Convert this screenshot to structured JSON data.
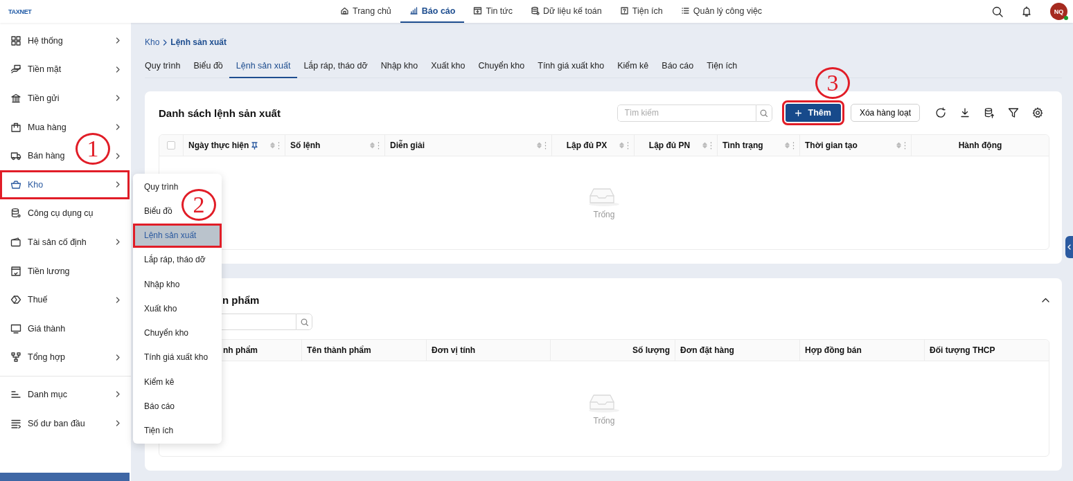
{
  "logo": {
    "text": "TAXNET"
  },
  "top_nav": [
    {
      "label": "Trang chủ",
      "selected": false
    },
    {
      "label": "Báo cáo",
      "selected": true
    },
    {
      "label": "Tin tức",
      "selected": false
    },
    {
      "label": "Dữ liệu kế toán",
      "selected": false
    },
    {
      "label": "Tiện ích",
      "selected": false
    },
    {
      "label": "Quản lý công việc",
      "selected": false
    }
  ],
  "user": {
    "initials": "NQ",
    "online": true
  },
  "sidebar": {
    "groups": [
      [
        {
          "label": "Hệ thống",
          "has_submenu": true,
          "selected": false,
          "highlighted": false
        },
        {
          "label": "Tiền mặt",
          "has_submenu": true,
          "selected": false,
          "highlighted": false
        },
        {
          "label": "Tiền gửi",
          "has_submenu": true,
          "selected": false,
          "highlighted": false
        },
        {
          "label": "Mua hàng",
          "has_submenu": true,
          "selected": false,
          "highlighted": false
        },
        {
          "label": "Bán hàng",
          "has_submenu": true,
          "selected": false,
          "highlighted": false
        },
        {
          "label": "Kho",
          "has_submenu": true,
          "selected": true,
          "highlighted": true
        },
        {
          "label": "Công cụ dụng cụ",
          "has_submenu": false,
          "selected": false,
          "highlighted": false
        },
        {
          "label": "Tài sản cố định",
          "has_submenu": true,
          "selected": false,
          "highlighted": false
        },
        {
          "label": "Tiền lương",
          "has_submenu": false,
          "selected": false,
          "highlighted": false
        },
        {
          "label": "Thuế",
          "has_submenu": true,
          "selected": false,
          "highlighted": false
        },
        {
          "label": "Giá thành",
          "has_submenu": false,
          "selected": false,
          "highlighted": false
        },
        {
          "label": "Tổng hợp",
          "has_submenu": true,
          "selected": false,
          "highlighted": false
        }
      ],
      [
        {
          "label": "Danh mục",
          "has_submenu": true,
          "selected": false,
          "highlighted": false
        },
        {
          "label": "Số dư ban đầu",
          "has_submenu": true,
          "selected": false,
          "highlighted": false
        }
      ]
    ]
  },
  "submenu": [
    {
      "label": "Quy trình",
      "selected": false,
      "highlighted": false
    },
    {
      "label": "Biểu đồ",
      "selected": false,
      "highlighted": false
    },
    {
      "label": "Lệnh sản xuất",
      "selected": true,
      "highlighted": true
    },
    {
      "label": "Lắp ráp, tháo dỡ",
      "selected": false,
      "highlighted": false
    },
    {
      "label": "Nhập kho",
      "selected": false,
      "highlighted": false
    },
    {
      "label": "Xuất kho",
      "selected": false,
      "highlighted": false
    },
    {
      "label": "Chuyển kho",
      "selected": false,
      "highlighted": false
    },
    {
      "label": "Tính giá xuất kho",
      "selected": false,
      "highlighted": false
    },
    {
      "label": "Kiểm kê",
      "selected": false,
      "highlighted": false
    },
    {
      "label": "Báo cáo",
      "selected": false,
      "highlighted": false
    },
    {
      "label": "Tiện ích",
      "selected": false,
      "highlighted": false
    }
  ],
  "breadcrumb": [
    "Kho",
    "Lệnh sản xuất"
  ],
  "tabs": [
    {
      "label": "Quy trình",
      "selected": false
    },
    {
      "label": "Biểu đồ",
      "selected": false
    },
    {
      "label": "Lệnh sản xuất",
      "selected": true
    },
    {
      "label": "Lắp ráp, tháo dỡ",
      "selected": false
    },
    {
      "label": "Nhập kho",
      "selected": false
    },
    {
      "label": "Xuất kho",
      "selected": false
    },
    {
      "label": "Chuyển kho",
      "selected": false
    },
    {
      "label": "Tính giá xuất kho",
      "selected": false
    },
    {
      "label": "Kiểm kê",
      "selected": false
    },
    {
      "label": "Báo cáo",
      "selected": false
    },
    {
      "label": "Tiện ích",
      "selected": false
    }
  ],
  "orders_panel": {
    "title": "Danh sách lệnh sản xuất",
    "search": {
      "placeholder": "Tìm kiếm"
    },
    "add_button": {
      "label": "Thêm",
      "highlighted": true
    },
    "bulk_delete_button": {
      "label": "Xóa hàng loạt"
    },
    "table": {
      "columns": [
        {
          "label": "Ngày thực hiện",
          "sortable": true,
          "pinned": true
        },
        {
          "label": "Số lệnh",
          "sortable": true,
          "pinned": false
        },
        {
          "label": "Diễn giải",
          "sortable": true,
          "pinned": false
        },
        {
          "label": "Lập đủ PX",
          "sortable": true,
          "pinned": false
        },
        {
          "label": "Lập đủ PN",
          "sortable": true,
          "pinned": false
        },
        {
          "label": "Tình trạng",
          "sortable": true,
          "pinned": false
        },
        {
          "label": "Thời gian tạo",
          "sortable": true,
          "pinned": false
        },
        {
          "label": "Hành động",
          "sortable": false,
          "pinned": false
        }
      ],
      "select_all_checked": false,
      "empty_text": "Trống"
    }
  },
  "products_panel": {
    "title": "n phẩm",
    "expanded": true,
    "table": {
      "columns": [
        {
          "label": "nh phẩm"
        },
        {
          "label": "Tên thành phẩm"
        },
        {
          "label": "Đơn vị tính"
        },
        {
          "label": "Số lượng"
        },
        {
          "label": "Đơn đặt hàng"
        },
        {
          "label": "Hợp đồng bán"
        },
        {
          "label": "Đối tượng THCP"
        }
      ],
      "empty_text": "Trống"
    }
  },
  "annotations": [
    {
      "label": "1"
    },
    {
      "label": "2"
    },
    {
      "label": "3"
    }
  ]
}
